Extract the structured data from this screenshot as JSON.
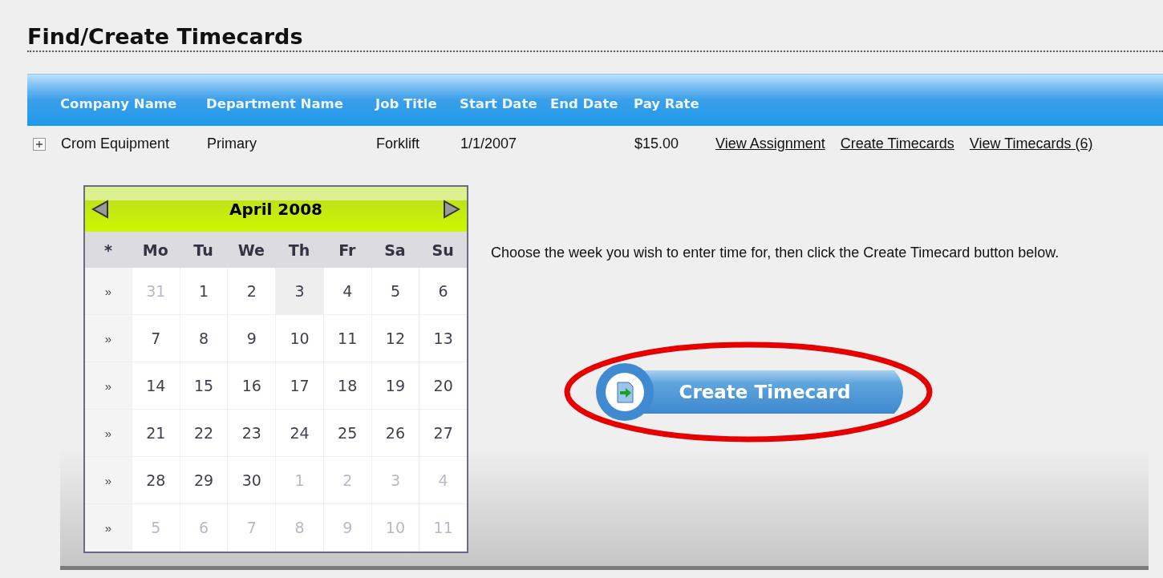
{
  "title": "Find/Create Timecards",
  "table": {
    "columns": [
      "Company Name",
      "Department Name",
      "Job Title",
      "Start Date",
      "End Date",
      "Pay Rate"
    ],
    "rows": [
      {
        "expanded": false,
        "cells": [
          "Crom Equipment",
          "Primary",
          "Forklift",
          "1/1/2007",
          "",
          "$15.00"
        ],
        "links": [
          "View Assignment",
          "Create Timecards",
          "View Timecards (6)"
        ]
      }
    ]
  },
  "calendar": {
    "month": "April 2008",
    "corner": "*",
    "weekdays": [
      "Mo",
      "Tu",
      "We",
      "Th",
      "Fr",
      "Sa",
      "Su"
    ],
    "weeks": [
      {
        "selector": "»",
        "days": [
          {
            "label": "31",
            "muted": true,
            "highlighted": false
          },
          {
            "label": "1",
            "muted": false,
            "highlighted": false
          },
          {
            "label": "2",
            "muted": false,
            "highlighted": false
          },
          {
            "label": "3",
            "muted": false,
            "highlighted": true
          },
          {
            "label": "4",
            "muted": false,
            "highlighted": false
          },
          {
            "label": "5",
            "muted": false,
            "highlighted": false
          },
          {
            "label": "6",
            "muted": false,
            "highlighted": false
          }
        ]
      },
      {
        "selector": "»",
        "days": [
          {
            "label": "7",
            "muted": false,
            "highlighted": false
          },
          {
            "label": "8",
            "muted": false,
            "highlighted": false
          },
          {
            "label": "9",
            "muted": false,
            "highlighted": false
          },
          {
            "label": "10",
            "muted": false,
            "highlighted": false
          },
          {
            "label": "11",
            "muted": false,
            "highlighted": false
          },
          {
            "label": "12",
            "muted": false,
            "highlighted": false
          },
          {
            "label": "13",
            "muted": false,
            "highlighted": false
          }
        ]
      },
      {
        "selector": "»",
        "days": [
          {
            "label": "14",
            "muted": false,
            "highlighted": false
          },
          {
            "label": "15",
            "muted": false,
            "highlighted": false
          },
          {
            "label": "16",
            "muted": false,
            "highlighted": false
          },
          {
            "label": "17",
            "muted": false,
            "highlighted": false
          },
          {
            "label": "18",
            "muted": false,
            "highlighted": false
          },
          {
            "label": "19",
            "muted": false,
            "highlighted": false
          },
          {
            "label": "20",
            "muted": false,
            "highlighted": false
          }
        ]
      },
      {
        "selector": "»",
        "days": [
          {
            "label": "21",
            "muted": false,
            "highlighted": false
          },
          {
            "label": "22",
            "muted": false,
            "highlighted": false
          },
          {
            "label": "23",
            "muted": false,
            "highlighted": false
          },
          {
            "label": "24",
            "muted": false,
            "highlighted": false
          },
          {
            "label": "25",
            "muted": false,
            "highlighted": false
          },
          {
            "label": "26",
            "muted": false,
            "highlighted": false
          },
          {
            "label": "27",
            "muted": false,
            "highlighted": false
          }
        ]
      },
      {
        "selector": "»",
        "days": [
          {
            "label": "28",
            "muted": false,
            "highlighted": false
          },
          {
            "label": "29",
            "muted": false,
            "highlighted": false
          },
          {
            "label": "30",
            "muted": false,
            "highlighted": false
          },
          {
            "label": "1",
            "muted": true,
            "highlighted": false
          },
          {
            "label": "2",
            "muted": true,
            "highlighted": false
          },
          {
            "label": "3",
            "muted": true,
            "highlighted": false
          },
          {
            "label": "4",
            "muted": true,
            "highlighted": false
          }
        ]
      },
      {
        "selector": "»",
        "days": [
          {
            "label": "5",
            "muted": true,
            "highlighted": false
          },
          {
            "label": "6",
            "muted": true,
            "highlighted": false
          },
          {
            "label": "7",
            "muted": true,
            "highlighted": false
          },
          {
            "label": "8",
            "muted": true,
            "highlighted": false
          },
          {
            "label": "9",
            "muted": true,
            "highlighted": false
          },
          {
            "label": "10",
            "muted": true,
            "highlighted": false
          },
          {
            "label": "11",
            "muted": true,
            "highlighted": false
          }
        ]
      }
    ]
  },
  "instruction": "Choose the week you wish to enter time for, then click the Create Timecard button below.",
  "create_button": {
    "label": "Create Timecard",
    "circled": true
  }
}
